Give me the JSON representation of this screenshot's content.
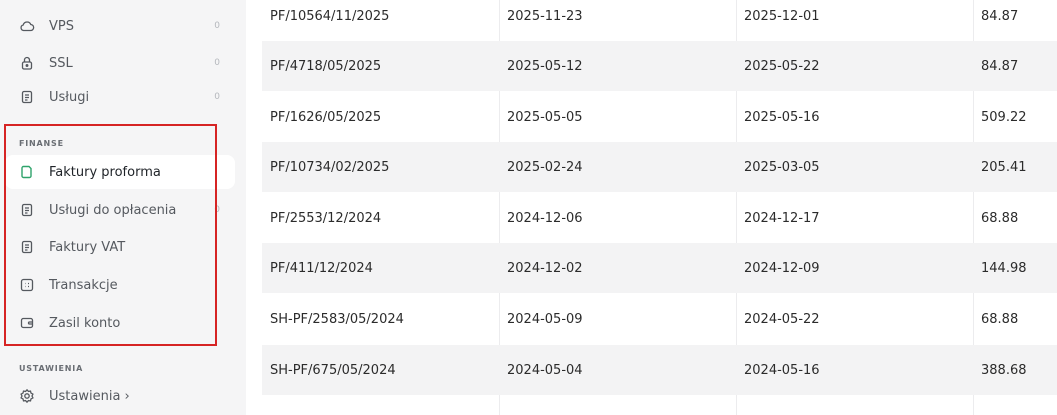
{
  "sidebar": {
    "top_items": [
      {
        "label": "VPS",
        "count": "0",
        "icon": "cloud-icon"
      },
      {
        "label": "SSL",
        "count": "0",
        "icon": "lock-icon"
      },
      {
        "label": "Usługi",
        "count": "0",
        "icon": "document-icon"
      }
    ],
    "finanse_label": "FINANSE",
    "finanse_items": [
      {
        "label": "Faktury proforma",
        "icon": "proforma-icon",
        "active": true
      },
      {
        "label": "Usługi do opłacenia",
        "count": "0",
        "icon": "document-icon"
      },
      {
        "label": "Faktury VAT",
        "icon": "document-icon"
      },
      {
        "label": "Transakcje",
        "icon": "transactions-icon"
      },
      {
        "label": "Zasil konto",
        "icon": "wallet-icon"
      }
    ],
    "ustawienia_label": "USTAWIENIA",
    "settings_item": {
      "label": "Ustawienia ›",
      "icon": "gear-icon"
    },
    "active_color": "#2fa36b",
    "highlight_color": "#d62424"
  },
  "table": {
    "rows": [
      {
        "number": "PF/10564/11/2025",
        "issued": "2025-11-23",
        "due": "2025-12-01",
        "amount": "84.87"
      },
      {
        "number": "PF/4718/05/2025",
        "issued": "2025-05-12",
        "due": "2025-05-22",
        "amount": "84.87"
      },
      {
        "number": "PF/1626/05/2025",
        "issued": "2025-05-05",
        "due": "2025-05-16",
        "amount": "509.22"
      },
      {
        "number": "PF/10734/02/2025",
        "issued": "2025-02-24",
        "due": "2025-03-05",
        "amount": "205.41"
      },
      {
        "number": "PF/2553/12/2024",
        "issued": "2024-12-06",
        "due": "2024-12-17",
        "amount": "68.88"
      },
      {
        "number": "PF/411/12/2024",
        "issued": "2024-12-02",
        "due": "2024-12-09",
        "amount": "144.98"
      },
      {
        "number": "SH-PF/2583/05/2024",
        "issued": "2024-05-09",
        "due": "2024-05-22",
        "amount": "68.88"
      },
      {
        "number": "SH-PF/675/05/2024",
        "issued": "2024-05-04",
        "due": "2024-05-16",
        "amount": "388.68"
      }
    ]
  }
}
